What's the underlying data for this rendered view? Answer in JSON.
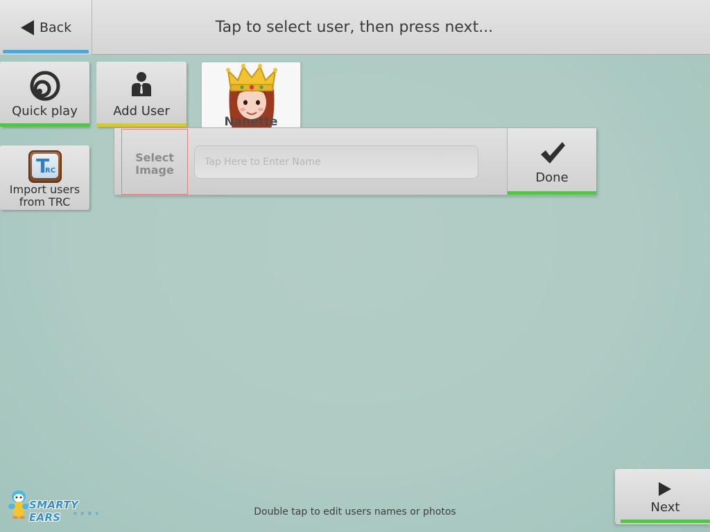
{
  "header": {
    "back_label": "Back",
    "title": "Tap to select user, then press next..."
  },
  "tiles": {
    "quick_play": {
      "label": "Quick play",
      "icon": "quick-play-icon",
      "bar_color": "#55c24a"
    },
    "add_user": {
      "label": "Add User",
      "icon": "user-icon",
      "bar_color": "#d4c93a"
    },
    "import_trc": {
      "label_line1": "Import users",
      "label_line2": "from TRC",
      "icon": "trc-icon",
      "icon_text_main": "T",
      "icon_text_sub": "RC"
    }
  },
  "users": [
    {
      "name": "Nanette",
      "icon": "queen-avatar"
    }
  ],
  "entry_panel": {
    "select_image_line1": "Select",
    "select_image_line2": "Image",
    "name_placeholder": "Tap Here to Enter Name",
    "name_value": "",
    "done_label": "Done"
  },
  "footer": {
    "hint": "Double tap to edit users names or photos",
    "next_label": "Next",
    "logo_text": "SMARTY EARS",
    "logo_sub": "a p p s"
  },
  "colors": {
    "accent_blue": "#4ea6d8",
    "accent_green": "#55c24a",
    "accent_yellow": "#d4c93a",
    "background": "#b3cdc6"
  }
}
